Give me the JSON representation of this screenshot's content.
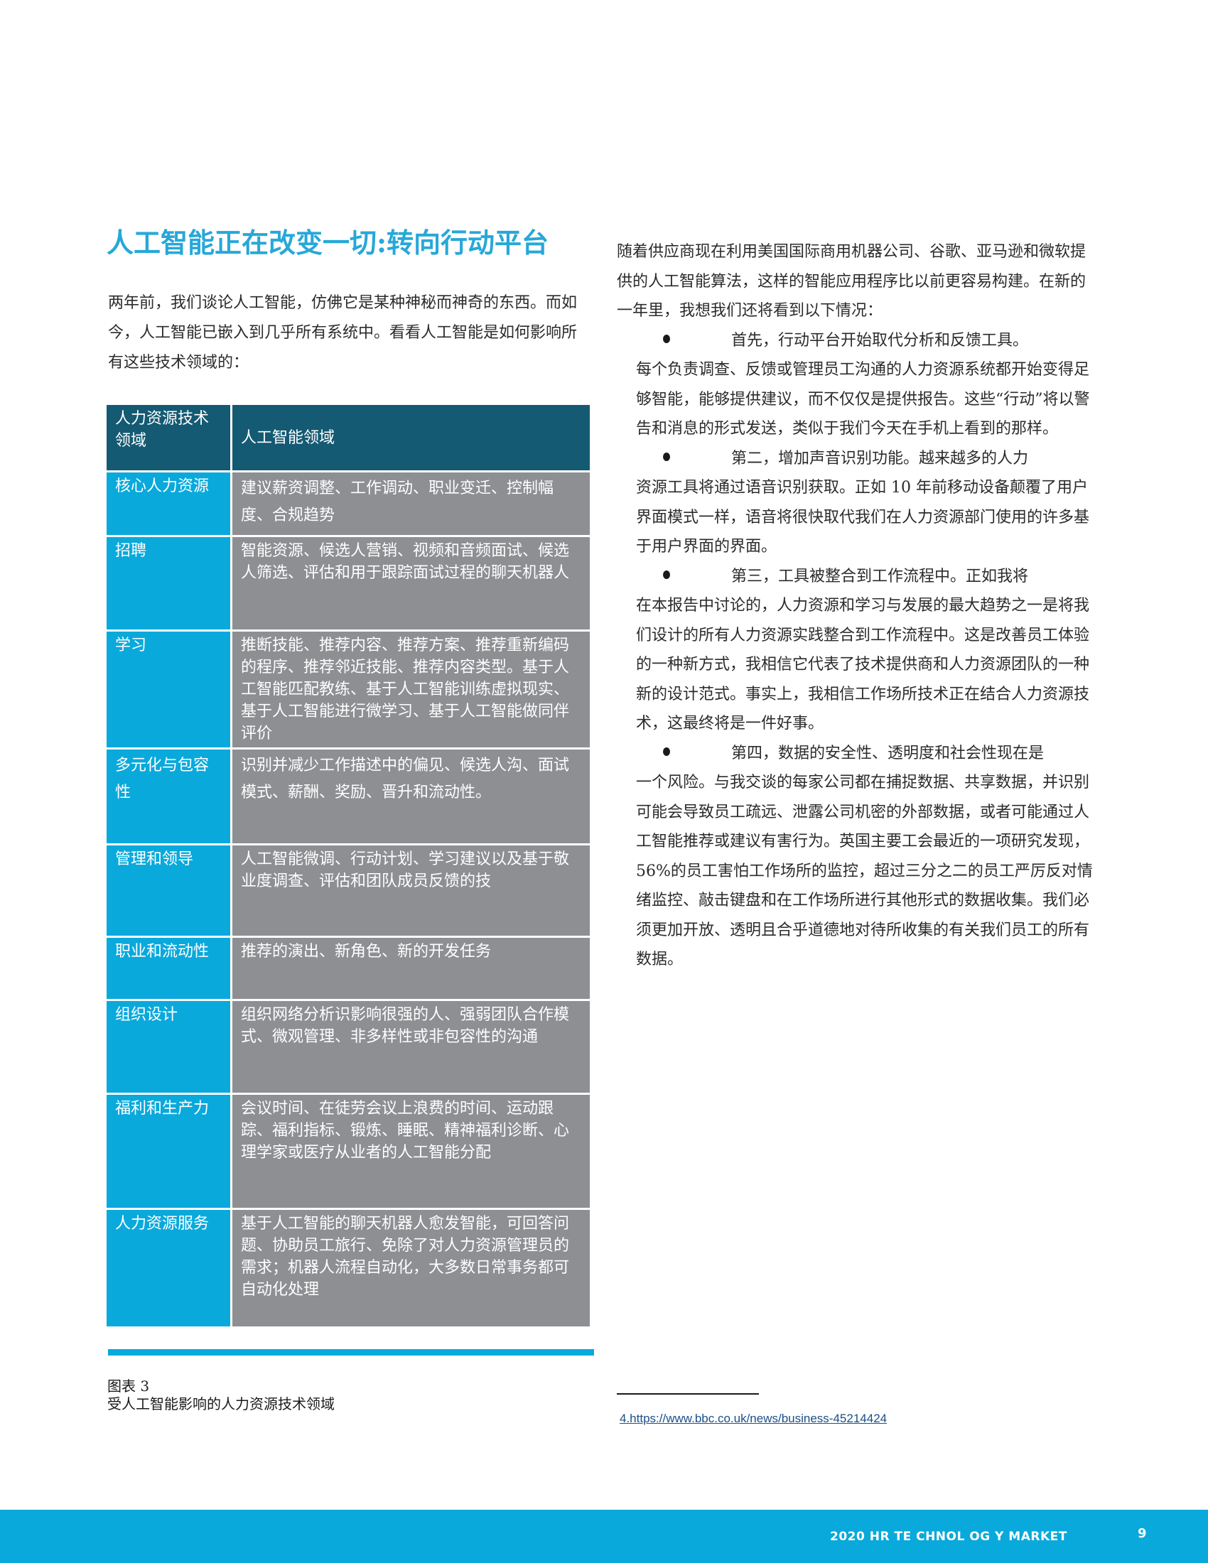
{
  "title": "人工智能正在改变一切:转向行动平台",
  "intro": "两年前，我们谈论人工智能，仿佛它是某种神秘而神奇的东西。而如今，人工智能已嵌入到几乎所有系统中。看看人工智能是如何影响所有这些技术领域的：",
  "table": {
    "headers": [
      "人力资源技术领域",
      "人工智能领域"
    ],
    "rows": [
      {
        "area": "核心人力资源",
        "ai": "建议薪资调整、工作调动、职业变迁、控制幅度、合规趋势"
      },
      {
        "area": "招聘",
        "ai": "智能资源、候选人营销、视频和音频面试、候选人筛选、评估和用于跟踪面试过程的聊天机器人"
      },
      {
        "area": "学习",
        "ai": "推断技能、推荐内容、推荐方案、推荐重新编码的程序、推荐邻近技能、推荐内容类型。基于人工智能匹配教练、基于人工智能训练虚拟现实、基于人工智能进行微学习、基于人工智能做同伴评价"
      },
      {
        "area": "多元化与包容性",
        "ai": "识别并减少工作描述中的偏见、候选人沟、面试模式、薪酬、奖励、晋升和流动性。"
      },
      {
        "area": "管理和领导",
        "ai": "人工智能微调、行动计划、学习建议以及基于敬业度调查、评估和团队成员反馈的技"
      },
      {
        "area": "职业和流动性",
        "ai": "推荐的演出、新角色、新的开发任务"
      },
      {
        "area": "组织设计",
        "ai": "组织网络分析识影响很强的人、强弱团队合作模式、微观管理、非多样性或非包容性的沟通"
      },
      {
        "area": "福利和生产力",
        "ai": "会议时间、在徒劳会议上浪费的时间、运动跟踪、福利指标、锻炼、睡眠、精神福利诊断、心理学家或医疗从业者的人工智能分配"
      },
      {
        "area": "人力资源服务",
        "ai": "基于人工智能的聊天机器人愈发智能，可回答问题、协助员工旅行、免除了对人力资源管理员的需求；机器人流程自动化，大多数日常事务都可 自动化处理"
      }
    ]
  },
  "figure": {
    "label": "图表 3",
    "caption": "受人工智能影响的人力资源技术领域"
  },
  "right_column": {
    "lead": "随着供应商现在利用美国国际商用机器公司、谷歌、亚马逊和微软提供的人工智能算法，这样的智能应用程序比以前更容易构建。在新的一年里，我想我们还将看到以下情况：",
    "bullets": [
      {
        "first": "首先，行动平台开始取代分析和反馈工具。",
        "rest": "每个负责调查、反馈或管理员工沟通的人力资源系统都开始变得足够智能，能够提供建议，而不仅仅是提供报告。这些“行动”将以警告和消息的形式发送，类似于我们今天在手机上看到的那样。"
      },
      {
        "first": "第二，增加声音识别功能。越来越多的人力",
        "rest": "资源工具将通过语音识别获取。正如 10 年前移动设备颠覆了用户界面模式一样，语音将很快取代我们在人力资源部门使用的许多基于用户界面的界面。"
      },
      {
        "first": "第三，工具被整合到工作流程中。正如我将",
        "rest": "在本报告中讨论的，人力资源和学习与发展的最大趋势之一是将我们设计的所有人力资源实践整合到工作流程中。这是改善员工体验的一种新方式，我相信它代表了技术提供商和人力资源团队的一种新的设计范式。事实上，我相信工作场所技术正在结合人力资源技术，这最终将是一件好事。"
      },
      {
        "first": "第四，数据的安全性、透明度和社会性现在是",
        "rest": "一个风险。与我交谈的每家公司都在捕捉数据、共享数据，并识别可能会导致员工疏远、泄露公司机密的外部数据，或者可能通过人工智能推荐或建议有害行为。英国主要工会最近的一项研究发现，56%的员工害怕工作场所的监控，超过三分之二的员工严厉反对情绪监控、敲击键盘和在工作场所进行其他形式的数据收集。我们必须更加开放、透明且合乎道德地对待所收集的有关我们员工的所有数据。"
      }
    ]
  },
  "footnote": "4.https://www.bbc.co.uk/news/business-45214424",
  "footer": {
    "text": "2020 HR TE CHNOL OG Y MARKET",
    "page_number": "9"
  },
  "colors": {
    "accent_blue": "#0aa9dc",
    "header_navy": "#155a73",
    "cell_gray": "#8e8f93",
    "title_blue": "#27a8d8"
  }
}
